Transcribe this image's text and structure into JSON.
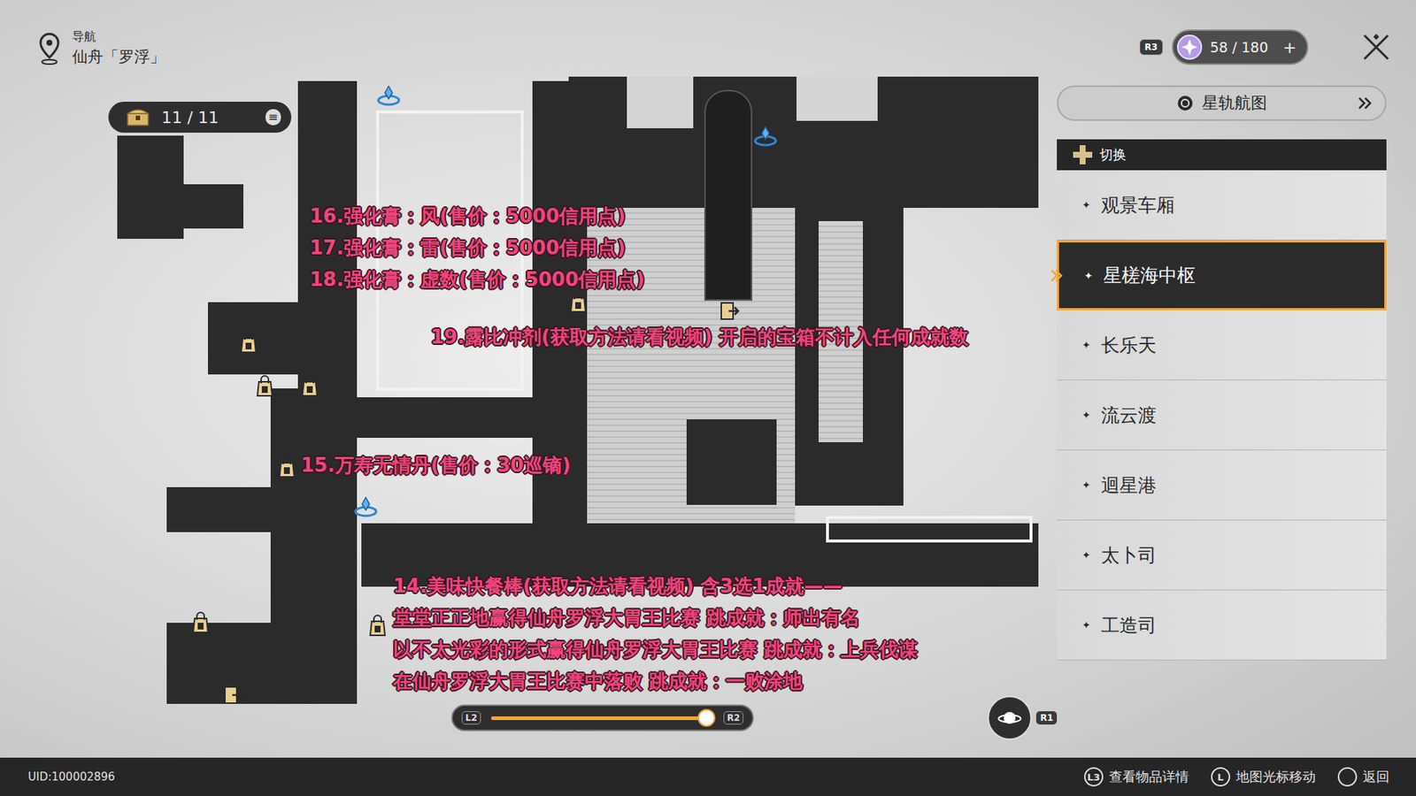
{
  "navigation": {
    "label": "导航",
    "location": "仙舟「罗浮」"
  },
  "chest_counter": {
    "text": "11 / 11",
    "menu": "≡"
  },
  "stamina": {
    "badge": "R3",
    "value": "58 / 180",
    "add": "+"
  },
  "star_rail_map_button": {
    "label": "星轨航图"
  },
  "area_switch": {
    "header": "切换",
    "marker": "✦",
    "items": [
      {
        "label": "观景车厢",
        "selected": false
      },
      {
        "label": "星槎海中枢",
        "selected": true
      },
      {
        "label": "长乐天",
        "selected": false
      },
      {
        "label": "流云渡",
        "selected": false
      },
      {
        "label": "迴星港",
        "selected": false
      },
      {
        "label": "太卜司",
        "selected": false
      },
      {
        "label": "工造司",
        "selected": false
      }
    ]
  },
  "map_annotations": [
    {
      "lines": [
        "16.强化膏：风(售价：5000信用点)",
        "17.强化膏：雷(售价：5000信用点)",
        "18.强化膏：虚数(售价：5000信用点)"
      ]
    },
    {
      "lines": [
        "19.露比冲剂(获取方法请看视频) 开启的宝箱不计入任何成就数"
      ]
    },
    {
      "lines": [
        "15.万寿无情丹(售价：30巡镝)"
      ]
    },
    {
      "lines": [
        "14.美味快餐棒(获取方法请看视频) 含3选1成就——",
        "堂堂正正地赢得仙舟罗浮大胃王比赛 跳成就：师出有名",
        "以不太光彩的形式赢得仙舟罗浮大胃王比赛 跳成就：上兵伐谋",
        "在仙舟罗浮大胃王比赛中落败 跳成就：一败涂地"
      ]
    }
  ],
  "map_markers": [
    {
      "kind": "shop"
    },
    {
      "kind": "shop"
    },
    {
      "kind": "shop"
    },
    {
      "kind": "shop"
    },
    {
      "kind": "shop"
    },
    {
      "kind": "shop"
    },
    {
      "kind": "shop"
    },
    {
      "kind": "teleport"
    },
    {
      "kind": "teleport"
    },
    {
      "kind": "teleport"
    },
    {
      "kind": "exit"
    },
    {
      "kind": "exit"
    }
  ],
  "zoom": {
    "left": "L2",
    "right": "R2",
    "level": 0.97
  },
  "planet_button": {
    "key": "R1"
  },
  "status_bar": {
    "uid": "UID:100002896",
    "hints": [
      {
        "key": "L3",
        "label": "查看物品详情"
      },
      {
        "key": "L",
        "label": "地图光标移动"
      },
      {
        "key": "",
        "label": "返回"
      }
    ]
  }
}
